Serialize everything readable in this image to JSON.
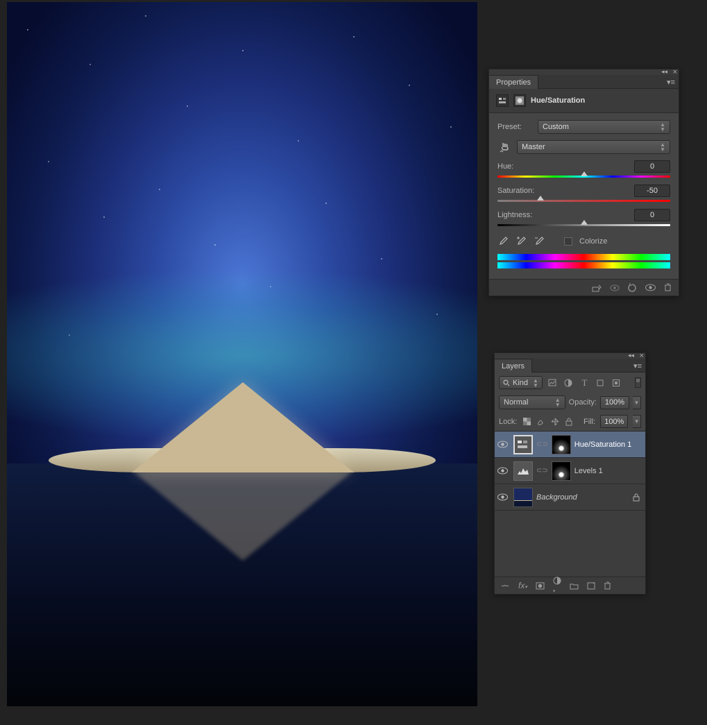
{
  "properties": {
    "panel_title": "Properties",
    "adjustment_title": "Hue/Saturation",
    "preset_label": "Preset:",
    "preset_value": "Custom",
    "channel_value": "Master",
    "hue_label": "Hue:",
    "hue_value": "0",
    "hue_pos_pct": 50,
    "sat_label": "Saturation:",
    "sat_value": "-50",
    "sat_pos_pct": 25,
    "light_label": "Lightness:",
    "light_value": "0",
    "light_pos_pct": 50,
    "colorize_label": "Colorize"
  },
  "layers": {
    "panel_title": "Layers",
    "kind_label": "Kind",
    "blend_mode": "Normal",
    "opacity_label": "Opacity:",
    "opacity_value": "100%",
    "lock_label": "Lock:",
    "fill_label": "Fill:",
    "fill_value": "100%",
    "rows": [
      {
        "name": "Hue/Saturation 1",
        "selected": true,
        "italic": false,
        "locked": false,
        "type": "adjustment",
        "mask": true
      },
      {
        "name": "Levels 1",
        "selected": false,
        "italic": false,
        "locked": false,
        "type": "adjustment-levels",
        "mask": true
      },
      {
        "name": "Background",
        "selected": false,
        "italic": true,
        "locked": true,
        "type": "image",
        "mask": false
      }
    ]
  }
}
